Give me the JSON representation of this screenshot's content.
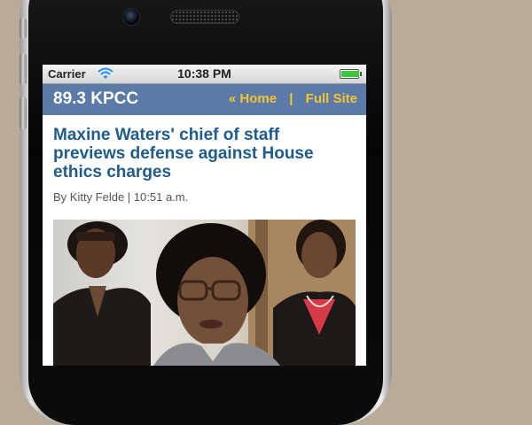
{
  "status_bar": {
    "carrier": "Carrier",
    "time": "10:38 PM",
    "battery_level": 1.0,
    "battery_color": "#3cc63c"
  },
  "nav": {
    "brand": "89.3 KPCC",
    "home_link": "« Home",
    "separator": "|",
    "full_site_link": "Full Site",
    "bar_color": "#5b7aa6",
    "link_color": "#f6c432"
  },
  "article": {
    "headline": "Maxine Waters' chief of staff previews defense against House ethics charges",
    "byline": "By Kitty Felde | 10:51 a.m.",
    "headline_color": "#1f5b8c",
    "photo_icon": "news-photo"
  },
  "background_color": "#b8ab98"
}
